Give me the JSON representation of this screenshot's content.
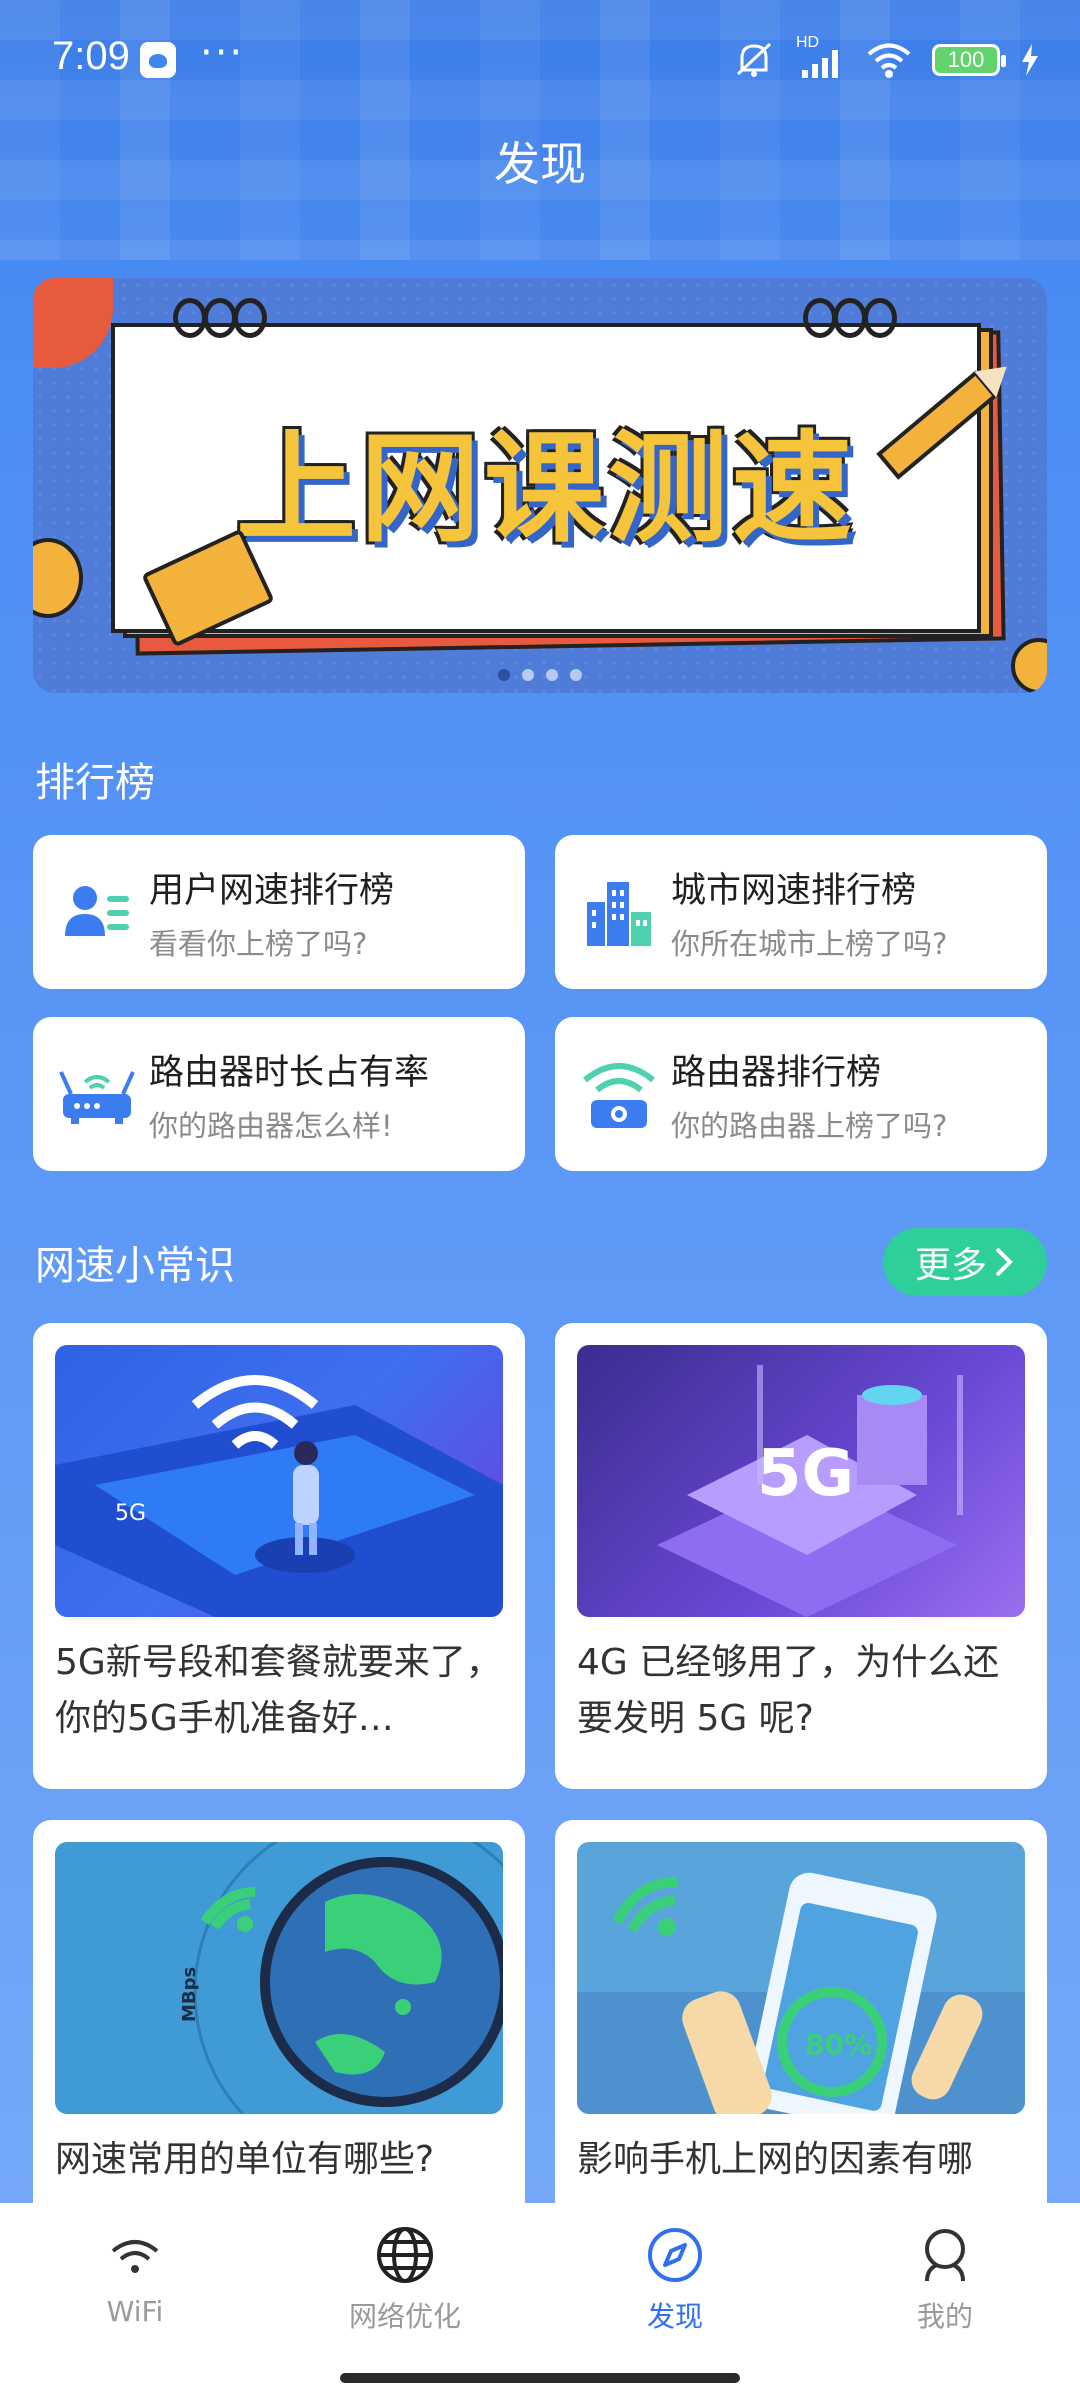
{
  "status_bar": {
    "time": "7:09",
    "dots": "···",
    "battery": "100",
    "network_label": "HD"
  },
  "page": {
    "title": "发现"
  },
  "banner": {
    "headline": "上网课测速",
    "pages": 4,
    "active_page": 1
  },
  "ranking": {
    "section_title": "排行榜",
    "cards": [
      {
        "title": "用户网速排行榜",
        "subtitle": "看看你上榜了吗?",
        "icon": "user-list-icon"
      },
      {
        "title": "城市网速排行榜",
        "subtitle": "你所在城市上榜了吗?",
        "icon": "city-buildings-icon"
      },
      {
        "title": "路由器时长占有率",
        "subtitle": "你的路由器怎么样!",
        "icon": "router-icon"
      },
      {
        "title": "路由器排行榜",
        "subtitle": "你的路由器上榜了吗?",
        "icon": "wifi-camera-icon"
      }
    ]
  },
  "tips": {
    "section_title": "网速小常识",
    "more_label": "更多",
    "articles": [
      {
        "title": "5G新号段和套餐就要来了，你的5G手机准备好…",
        "image_text": "5G"
      },
      {
        "title": "4G 已经够用了，为什么还要发明 5G 呢?",
        "image_text": "5G"
      },
      {
        "title": "网速常用的单位有哪些?",
        "image_text": "MBps"
      },
      {
        "title": "影响手机上网的因素有哪",
        "image_text": "80%"
      }
    ]
  },
  "bottom_nav": {
    "items": [
      {
        "label": "WiFi",
        "icon": "wifi-icon"
      },
      {
        "label": "网络优化",
        "icon": "globe-icon"
      },
      {
        "label": "发现",
        "icon": "compass-icon"
      },
      {
        "label": "我的",
        "icon": "person-icon"
      }
    ],
    "active_index": 2
  },
  "colors": {
    "accent": "#2f6ff0",
    "more_button": "#2fcf9b",
    "background": "#4d8ff4"
  }
}
